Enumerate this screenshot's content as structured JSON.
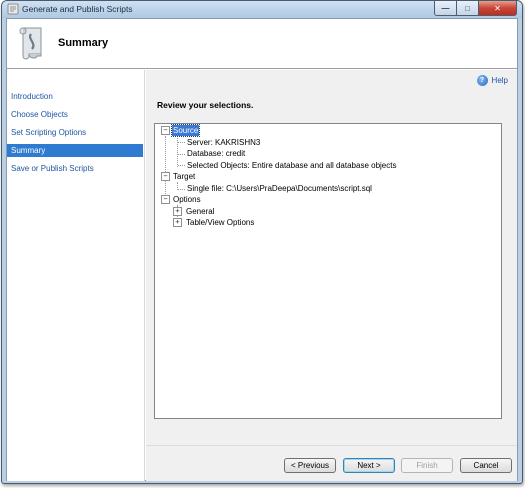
{
  "window": {
    "title": "Generate and Publish Scripts",
    "minimize_icon": "minimize-icon",
    "maximize_icon": "maximize-icon",
    "close_icon": "close-icon"
  },
  "header": {
    "title": "Summary",
    "icon": "script-scroll-icon"
  },
  "sidebar": {
    "items": [
      {
        "label": "Introduction",
        "active": false
      },
      {
        "label": "Choose Objects",
        "active": false
      },
      {
        "label": "Set Scripting Options",
        "active": false
      },
      {
        "label": "Summary",
        "active": true
      },
      {
        "label": "Save or Publish Scripts",
        "active": false
      }
    ]
  },
  "main": {
    "help_label": "Help",
    "review_label": "Review your selections.",
    "tree": {
      "source": {
        "label": "Source",
        "server": "Server: KAKRISHN3",
        "database": "Database: credit",
        "selected_objects": "Selected Objects: Entire database and all database objects"
      },
      "target": {
        "label": "Target",
        "single_file": "Single file: C:\\Users\\PraDeepa\\Documents\\script.sql"
      },
      "options": {
        "label": "Options",
        "general": "General",
        "table_view": "Table/View Options"
      }
    }
  },
  "footer": {
    "previous_label": "< Previous",
    "next_label": "Next >",
    "finish_label": "Finish",
    "cancel_label": "Cancel"
  },
  "colors": {
    "accent": "#2f7bd2",
    "link": "#1e55a5",
    "close_button": "#c9463a"
  }
}
